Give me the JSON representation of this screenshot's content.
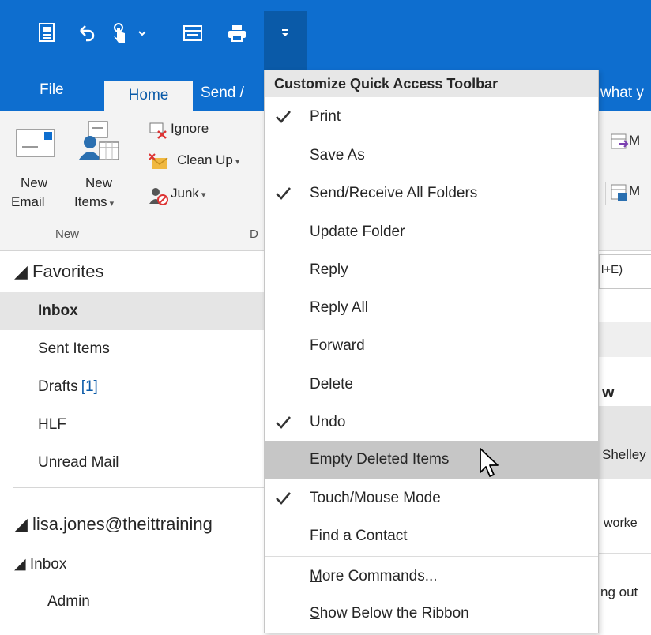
{
  "qat": {
    "icons": [
      "send-receive-icon",
      "undo-icon",
      "touch-mode-icon",
      "chevron-down-icon",
      "empty-deleted-icon",
      "print-icon",
      "customize-dropdown-icon"
    ]
  },
  "tabs": {
    "file": "File",
    "home": "Home",
    "send": "Send /",
    "tell": "what y"
  },
  "ribbon": {
    "new_email_line1": "New",
    "new_email_line2": "Email",
    "new_items_line1": "New",
    "new_items_line2": "Items",
    "ignore": "Ignore",
    "clean_up": "Clean Up",
    "junk": "Junk",
    "group_new": "New",
    "group_delete": "D",
    "right_1": "M",
    "right_2": "M"
  },
  "folders": {
    "favorites": "◢ Favorites",
    "items": [
      {
        "label": "Inbox",
        "count": ""
      },
      {
        "label": "Sent Items",
        "count": ""
      },
      {
        "label": "Drafts",
        "count": "[1]"
      },
      {
        "label": "HLF",
        "count": ""
      },
      {
        "label": "Unread Mail",
        "count": ""
      }
    ],
    "account": "◢ lisa.jones@theittraining",
    "inbox": "◢ Inbox",
    "admin": "Admin"
  },
  "right_snippets": {
    "search_hint": "l+E)",
    "w": "w",
    "shelley": "Shelley",
    "worked": "worke",
    "ngout": "ng out"
  },
  "menu": {
    "title": "Customize Quick Access Toolbar",
    "items": [
      {
        "label": "Print",
        "checked": true
      },
      {
        "label": "Save As",
        "checked": false
      },
      {
        "label": "Send/Receive All Folders",
        "checked": true
      },
      {
        "label": "Update Folder",
        "checked": false
      },
      {
        "label": "Reply",
        "checked": false
      },
      {
        "label": "Reply All",
        "checked": false
      },
      {
        "label": "Forward",
        "checked": false
      },
      {
        "label": "Delete",
        "checked": false
      },
      {
        "label": "Undo",
        "checked": true
      },
      {
        "label": "Empty Deleted Items",
        "checked": false,
        "highlighted": true
      },
      {
        "label": "Touch/Mouse Mode",
        "checked": true
      },
      {
        "label": "Find a Contact",
        "checked": false
      }
    ],
    "more_commands_u": "M",
    "more_commands_rest": "ore Commands...",
    "show_below_u": "S",
    "show_below_rest": "how Below the Ribbon"
  },
  "colors": {
    "title_bar": "#0e6ecf",
    "accent_blue": "#0a5aa8",
    "menu_highlight": "#c6c6c6"
  }
}
